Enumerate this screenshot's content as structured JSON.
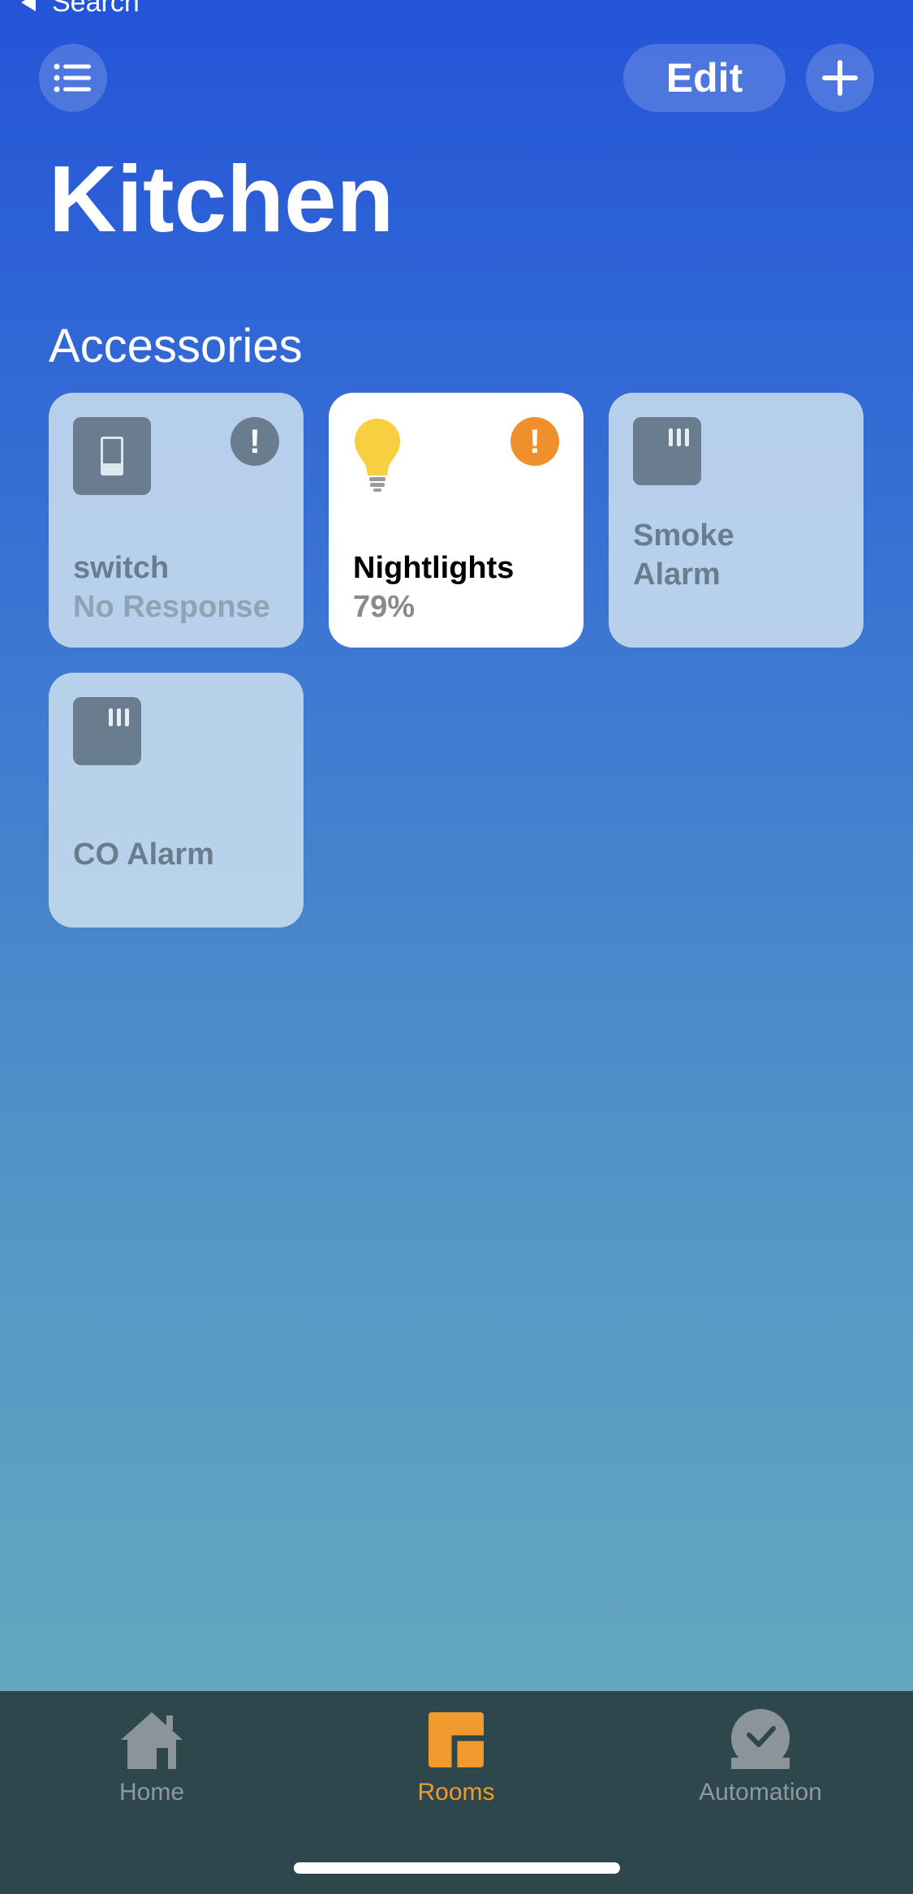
{
  "status_bar": {
    "back_label": "Search"
  },
  "header": {
    "edit_label": "Edit",
    "room_title": "Kitchen"
  },
  "accessories": {
    "section_title": "Accessories",
    "tiles": [
      {
        "name": "switch",
        "status": "No Response",
        "icon": "light-switch-icon",
        "badge": "!"
      },
      {
        "name": "Nightlights",
        "status": "79%",
        "icon": "lightbulb-icon",
        "badge": "!",
        "on": true,
        "brightness_percent": 79
      },
      {
        "name": "Smoke Alarm",
        "status": "",
        "icon": "smoke-alarm-icon"
      },
      {
        "name": "CO Alarm",
        "status": "",
        "icon": "co-alarm-icon"
      }
    ]
  },
  "tab_bar": {
    "tabs": [
      {
        "label": "Home",
        "icon": "house-icon",
        "selected": false
      },
      {
        "label": "Rooms",
        "icon": "rooms-icon",
        "selected": true
      },
      {
        "label": "Automation",
        "icon": "automation-clock-icon",
        "selected": false
      }
    ]
  },
  "colors": {
    "accent": "#f19a2e",
    "badge_orange": "#f0902c",
    "tab_bar_background": "#2d474d",
    "bulb_yellow": "#f8cf40"
  }
}
